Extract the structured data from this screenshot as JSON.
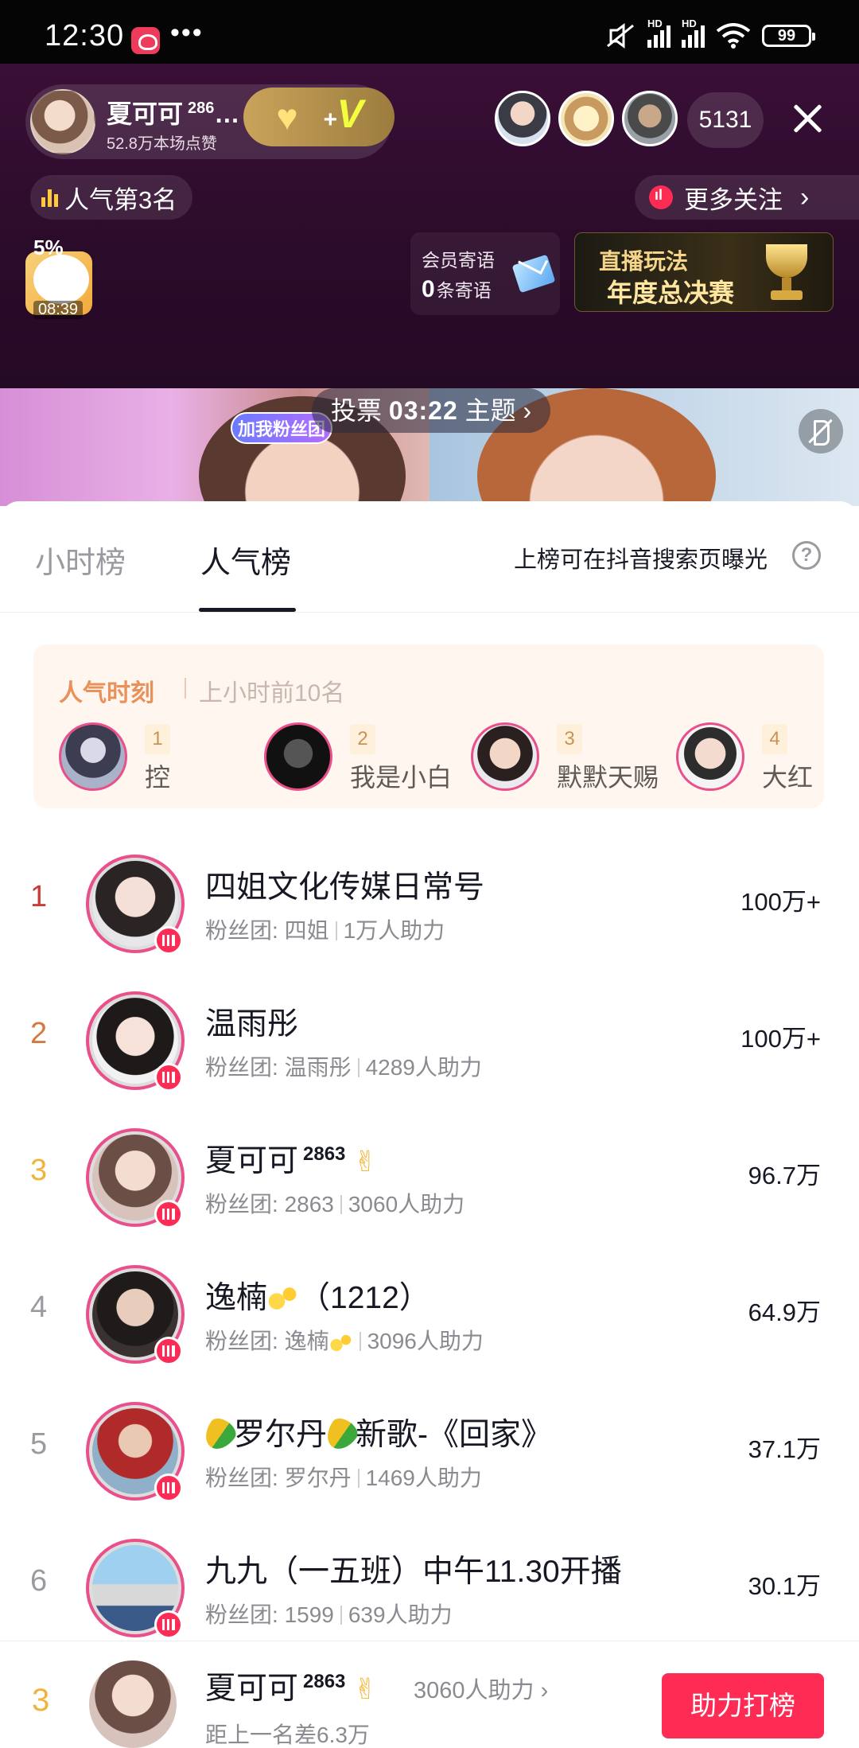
{
  "status_bar": {
    "time": "12:30",
    "dots": "•••",
    "battery": "99",
    "hd1": "HD",
    "hd2": "HD"
  },
  "live": {
    "host_name": "夏可可",
    "host_level": "286",
    "host_name_ellipsis": "…",
    "host_likes": "52.8万本场点赞",
    "vip_plus": "+",
    "vip_v": "V",
    "viewer_count": "5131",
    "popularity_rank": "人气第3名",
    "more_follow": "更多关注",
    "mini_percent": "5%",
    "mini_time": "08:39",
    "member_msg_title": "会员寄语",
    "member_msg_count": "0",
    "member_msg_unit": "条寄语",
    "finals_line1": "直播玩法",
    "finals_line2": "年度总决赛"
  },
  "video": {
    "fan_pill": "加我粉丝团",
    "vote_label": "投票",
    "vote_time": "03:22",
    "vote_topic": "主题",
    "vote_chevron": "›"
  },
  "tabs": {
    "hour": "小时榜",
    "popularity": "人气榜",
    "hint": "上榜可在抖音搜索页曝光",
    "help": "?"
  },
  "moment": {
    "title": "人气时刻",
    "subtitle": "上小时前10名",
    "items": [
      {
        "num": "1",
        "name": "控"
      },
      {
        "num": "2",
        "name": "我是小白"
      },
      {
        "num": "3",
        "name": "默默天赐"
      },
      {
        "num": "4",
        "name": "大红"
      }
    ]
  },
  "fan_prefix": "粉丝团: ",
  "rankings": [
    {
      "rank": "1",
      "name": "四姐文化传媒日常号",
      "level": "",
      "fan": "四姐",
      "helpers": "1万人助力",
      "score": "100万+"
    },
    {
      "rank": "2",
      "name": "温雨彤",
      "level": "",
      "fan": "温雨彤",
      "helpers": "4289人助力",
      "score": "100万+"
    },
    {
      "rank": "3",
      "name": "夏可可",
      "level": "2863",
      "fan": "2863",
      "helpers": "3060人助力",
      "score": "96.7万"
    },
    {
      "rank": "4",
      "name": "逸楠",
      "name_tail": "（1212）",
      "level": "",
      "fan": "逸楠",
      "helpers": "3096人助力",
      "score": "64.9万"
    },
    {
      "rank": "5",
      "name": "罗尔丹",
      "name_tail": "新歌-《回家》",
      "level": "",
      "fan": "罗尔丹",
      "helpers": "1469人助力",
      "score": "37.1万"
    },
    {
      "rank": "6",
      "name": "九九（一五班）中午11.30开播",
      "level": "",
      "fan": "1599",
      "helpers": "639人助力",
      "score": "30.1万"
    }
  ],
  "bottom": {
    "rank": "3",
    "name": "夏可可",
    "level": "2863",
    "helpers": "3060人助力 ›",
    "gap": "距上一名差6.3万",
    "button": "助力打榜"
  },
  "colors": {
    "accent": "#fe2c55",
    "rank1": "#c93a3a",
    "rank2": "#d7793f",
    "rank3": "#f0b43c",
    "rank_other": "#9a9aa0"
  }
}
